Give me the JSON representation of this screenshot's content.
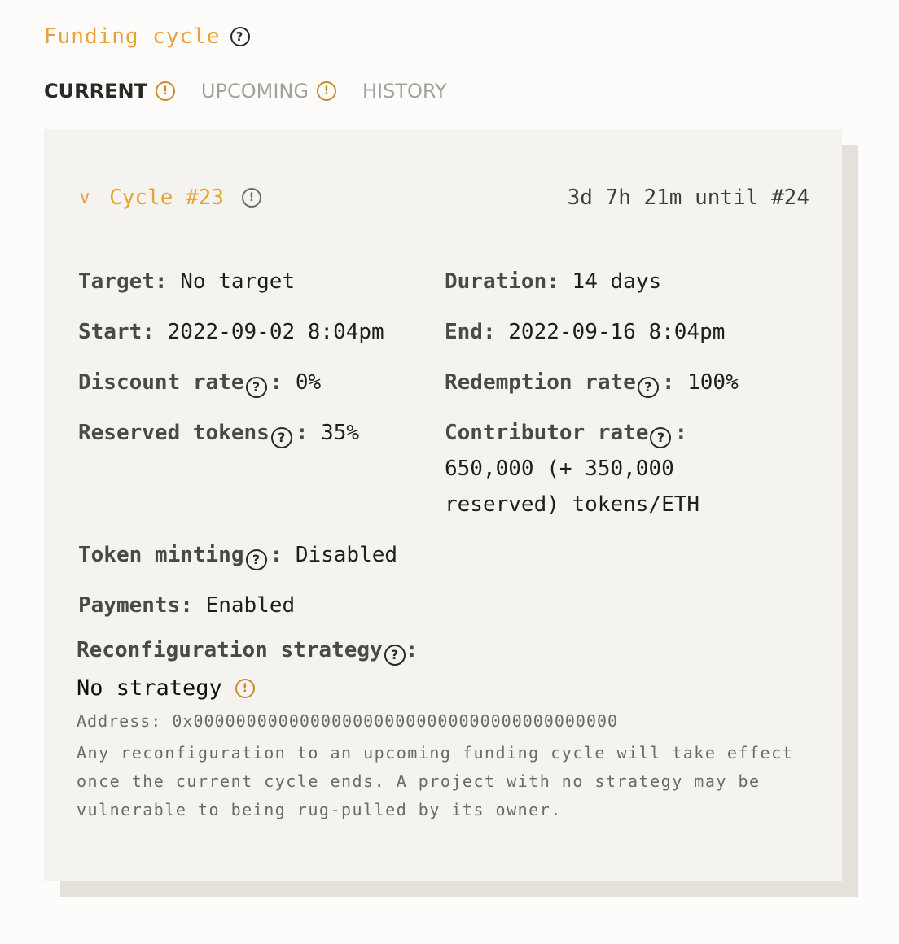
{
  "header": {
    "title": "Funding cycle",
    "help_icon": "question-circle-icon"
  },
  "tabs": [
    {
      "label": "CURRENT",
      "active": true,
      "icon": "exclamation-circle-icon"
    },
    {
      "label": "UPCOMING",
      "active": false,
      "icon": "exclamation-circle-icon"
    },
    {
      "label": "HISTORY",
      "active": false
    }
  ],
  "cycle": {
    "toggle_icon": "chevron-down-icon",
    "title": "Cycle #23",
    "countdown": "3d 7h 21m until #24",
    "fields": {
      "target": {
        "label": "Target",
        "value": "No target"
      },
      "duration": {
        "label": "Duration",
        "value": "14 days"
      },
      "start": {
        "label": "Start",
        "value": "2022-09-02 8:04pm"
      },
      "end": {
        "label": "End",
        "value": "2022-09-16 8:04pm"
      },
      "discount_rate": {
        "label": "Discount rate",
        "value": "0%"
      },
      "redemption_rate": {
        "label": "Redemption rate",
        "value": "100%"
      },
      "reserved_tokens": {
        "label": "Reserved tokens",
        "value": "35%"
      },
      "contributor_rate": {
        "label": "Contributor rate",
        "value_line1": "650,000 (+ 350,000",
        "value_line2": "reserved) tokens/ETH"
      },
      "token_minting": {
        "label": "Token minting",
        "value": "Disabled"
      },
      "payments": {
        "label": "Payments",
        "value": "Enabled"
      }
    },
    "reconfiguration": {
      "label": "Reconfiguration strategy",
      "strategy": "No strategy",
      "address_label": "Address:",
      "address": "0x0000000000000000000000000000000000000000",
      "note": "Any reconfiguration to an upcoming funding cycle will take effect once the current cycle ends. A project with no strategy may be vulnerable to being rug-pulled by its owner."
    }
  },
  "colors": {
    "accent": "#e8a235",
    "warning": "#c98a2b",
    "card_bg": "#f4f3ef",
    "shadow": "#e4e1db"
  }
}
